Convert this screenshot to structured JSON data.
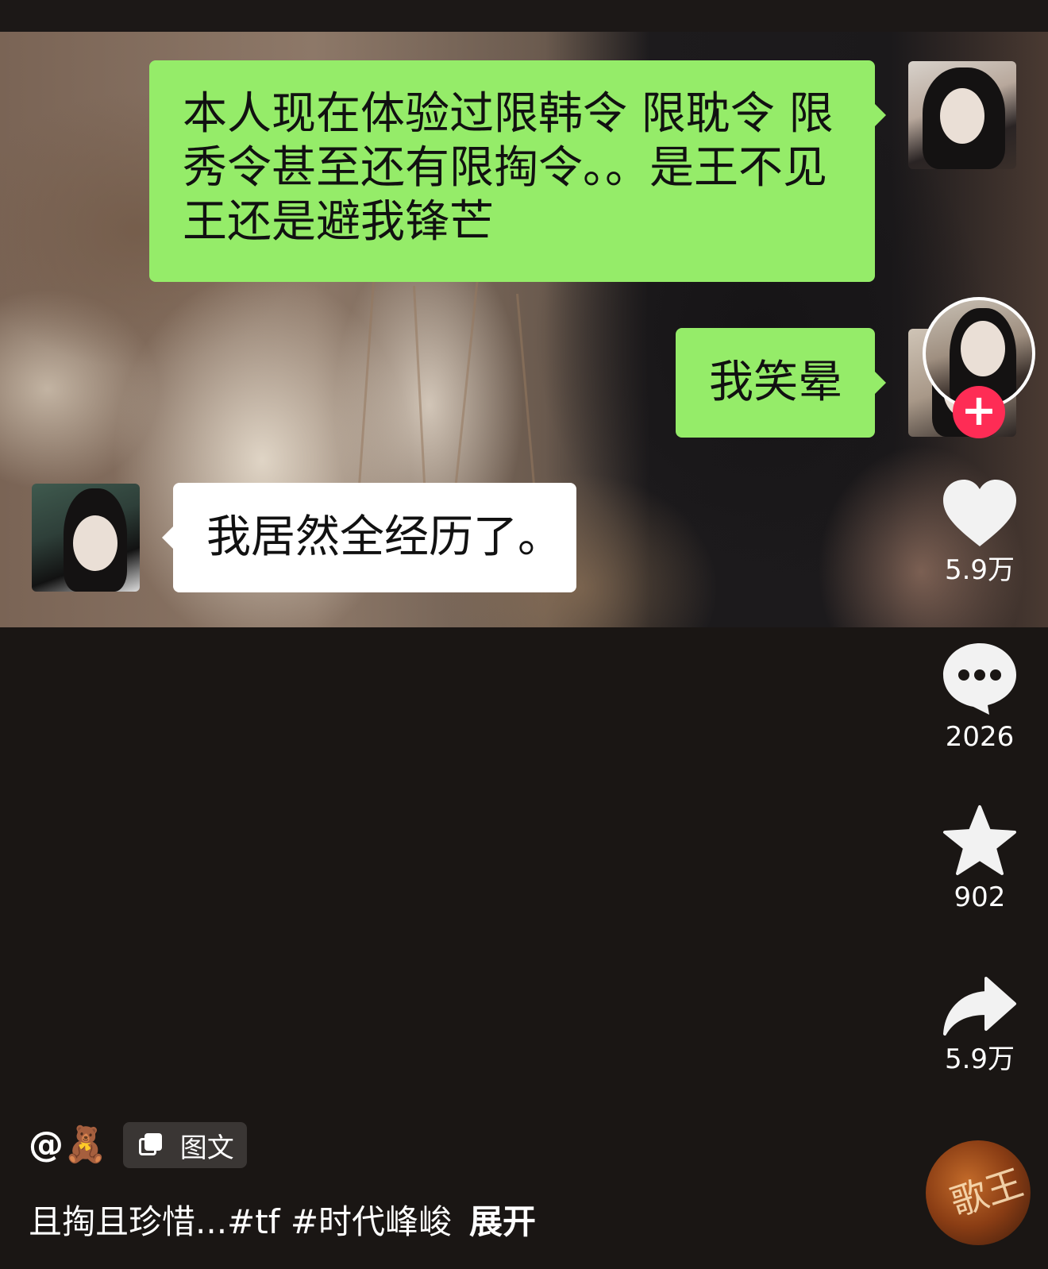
{
  "chat": {
    "message_1": "本人现在体验过限韩令 限耽令 限秀令甚至还有限掏令。。是王不见王还是避我锋芒",
    "message_2": "我笑晕",
    "message_3": "我居然全经历了。"
  },
  "actions": {
    "like_count": "5.9万",
    "comment_count": "2026",
    "favorite_count": "902",
    "share_count": "5.9万"
  },
  "follow_symbol": "+",
  "post": {
    "author": "@🧸",
    "type_tag": "图文",
    "caption": "且掏且珍惜...#tf #时代峰峻",
    "expand_label": "展开"
  },
  "music_disc_text": "歌王",
  "colors": {
    "chat_bubble_green": "#95ec69",
    "follow_red": "#fe2c55",
    "background": "#1a1614"
  },
  "icons": [
    "heart-icon",
    "comment-icon",
    "star-icon",
    "share-icon",
    "image-text-icon",
    "plus-icon"
  ]
}
